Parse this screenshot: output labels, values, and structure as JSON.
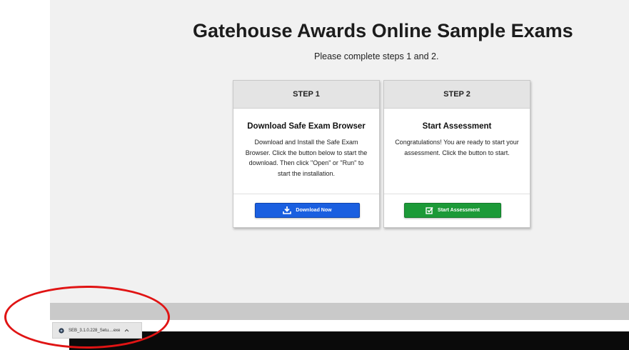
{
  "page": {
    "title": "Gatehouse Awards Online Sample Exams",
    "subtitle": "Please complete steps 1 and 2."
  },
  "step1": {
    "header": "STEP 1",
    "title": "Download Safe Exam Browser",
    "text": "Download and Install the Safe Exam Browser. Click the button below to start the download. Then click \"Open\" or \"Run\" to start the installation.",
    "button": "Download Now",
    "button_icon": "download-icon"
  },
  "step2": {
    "header": "STEP 2",
    "title": "Start Assessment",
    "text": "Congratulations! You are ready to start your assessment. Click the button to start.",
    "button": "Start Assessment",
    "button_icon": "checkbox-icon"
  },
  "download_shelf": {
    "filename": "SEB_3.1.0.228_Setu....exe",
    "chevron": "chevron-up-icon"
  },
  "colors": {
    "download_button": "#1a5fe0",
    "start_button": "#1c9a38",
    "highlight": "#e01414"
  }
}
